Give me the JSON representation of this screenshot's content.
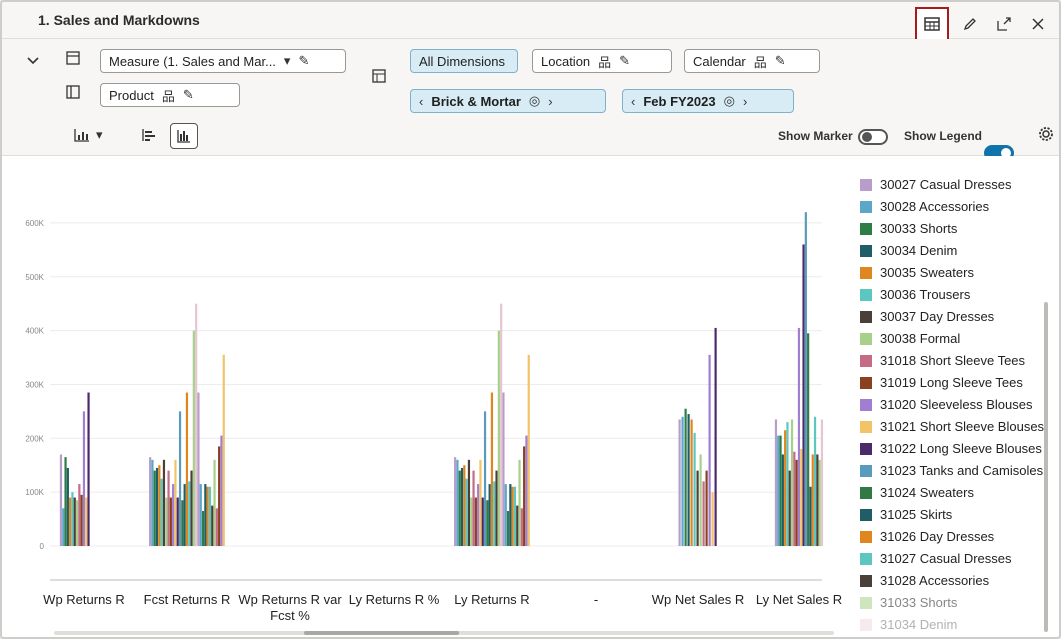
{
  "title": "1. Sales and Markdowns",
  "toolbar": {
    "measure_label": "Measure (1. Sales and Mar...",
    "product_label": "Product",
    "all_dimensions_label": "All Dimensions",
    "location_label": "Location",
    "calendar_label": "Calendar",
    "brick_label": "Brick & Mortar",
    "period_label": "Feb FY2023",
    "show_marker_label": "Show Marker",
    "show_legend_label": "Show Legend",
    "show_marker_on": false,
    "show_legend_on": true
  },
  "icons": {
    "table": "table-icon",
    "edit": "pencil-icon",
    "expand": "expand-icon",
    "close": "close-icon"
  },
  "colors": {
    "accent": "#0e74a9",
    "highlight_border": "#a51c1c"
  },
  "legend": {
    "items": [
      {
        "label": "30027 Casual Dresses",
        "color": "#b79ccc"
      },
      {
        "label": "30028 Accessories",
        "color": "#5aa7c7"
      },
      {
        "label": "30033 Shorts",
        "color": "#2e7d47"
      },
      {
        "label": "30034 Denim",
        "color": "#1f5e66"
      },
      {
        "label": "30035 Sweaters",
        "color": "#e0861f"
      },
      {
        "label": "30036 Trousers",
        "color": "#5cc6c0"
      },
      {
        "label": "30037 Day Dresses",
        "color": "#4a3f39"
      },
      {
        "label": "30038 Formal",
        "color": "#a7d08a"
      },
      {
        "label": "31018 Short Sleeve Tees",
        "color": "#c56b86"
      },
      {
        "label": "31019 Long Sleeve Tees",
        "color": "#8a4120"
      },
      {
        "label": "31020 Sleeveless Blouses",
        "color": "#a07ed1"
      },
      {
        "label": "31021 Short Sleeve Blouses",
        "color": "#f3c368"
      },
      {
        "label": "31022 Long Sleeve Blouses",
        "color": "#4b2a6a"
      },
      {
        "label": "31023 Tanks and Camisoles",
        "color": "#5a9bbd"
      },
      {
        "label": "31024 Sweaters",
        "color": "#327a44"
      },
      {
        "label": "31025 Skirts",
        "color": "#1f5e66"
      },
      {
        "label": "31026 Day Dresses",
        "color": "#e0861f"
      },
      {
        "label": "31027 Casual Dresses",
        "color": "#5cc6c0"
      },
      {
        "label": "31028 Accessories",
        "color": "#4a3f39"
      },
      {
        "label": "31033 Shorts",
        "color": "#a7d08a"
      },
      {
        "label": "31034 Denim",
        "color": "#e7c5d0"
      }
    ]
  },
  "chart_data": {
    "type": "bar",
    "ylim": [
      0,
      650000
    ],
    "yticks": [
      {
        "value": 0,
        "label": "0"
      },
      {
        "value": 100000,
        "label": "100K"
      },
      {
        "value": 200000,
        "label": "200K"
      },
      {
        "value": 300000,
        "label": "300K"
      },
      {
        "value": 400000,
        "label": "400K"
      },
      {
        "value": 500000,
        "label": "500K"
      },
      {
        "value": 600000,
        "label": "600K"
      }
    ],
    "categories": [
      "Wp Returns R",
      "Fcst Returns R",
      "Wp Returns R var Fcst %",
      "Ly Returns R %",
      "Ly Returns R",
      "-",
      "Wp Net Sales R",
      "Ly Net Sales R"
    ],
    "series_colors": [
      "#b79ccc",
      "#5aa7c7",
      "#2e7d47",
      "#1f5e66",
      "#e0861f",
      "#5cc6c0",
      "#4a3f39",
      "#a7d08a",
      "#c56b86",
      "#8a4120",
      "#a07ed1",
      "#f3c368",
      "#4b2a6a",
      "#5a9bbd",
      "#327a44",
      "#1f5e66",
      "#e0861f",
      "#5cc6c0",
      "#4a3f39",
      "#a7d08a",
      "#e7c5d0"
    ],
    "groups": [
      {
        "category": "Wp Returns R",
        "values": [
          170000,
          70000,
          165000,
          145000,
          90000,
          100000,
          90000,
          85000,
          115000,
          95000,
          250000,
          90000,
          285000,
          0,
          0,
          0,
          0,
          0,
          0,
          0,
          0
        ]
      },
      {
        "category": "Fcst Returns R",
        "values": [
          165000,
          160000,
          140000,
          145000,
          150000,
          125000,
          160000,
          90000,
          140000,
          90000,
          115000,
          160000,
          90000,
          250000,
          85000,
          115000,
          285000,
          120000,
          140000,
          400000,
          450000,
          285000,
          115000,
          65000,
          115000,
          110000,
          110000,
          75000,
          160000,
          70000,
          185000,
          205000,
          355000
        ]
      },
      {
        "category": "Wp Returns R var Fcst %",
        "values": []
      },
      {
        "category": "Ly Returns R %",
        "values": []
      },
      {
        "category": "Ly Returns R",
        "values": [
          165000,
          160000,
          140000,
          145000,
          150000,
          125000,
          160000,
          90000,
          140000,
          90000,
          115000,
          160000,
          90000,
          250000,
          85000,
          115000,
          285000,
          120000,
          140000,
          400000,
          450000,
          285000,
          115000,
          65000,
          115000,
          110000,
          110000,
          75000,
          160000,
          70000,
          185000,
          205000,
          355000
        ]
      },
      {
        "category": "-",
        "values": []
      },
      {
        "category": "Wp Net Sales R",
        "values": [
          235000,
          240000,
          255000,
          245000,
          235000,
          210000,
          140000,
          170000,
          120000,
          140000,
          355000,
          100000,
          405000
        ]
      },
      {
        "category": "Ly Net Sales R",
        "values": [
          235000,
          205000,
          205000,
          170000,
          215000,
          230000,
          140000,
          235000,
          175000,
          160000,
          405000,
          180000,
          560000,
          620000,
          395000,
          110000,
          170000,
          240000,
          170000,
          160000,
          235000
        ]
      }
    ]
  }
}
